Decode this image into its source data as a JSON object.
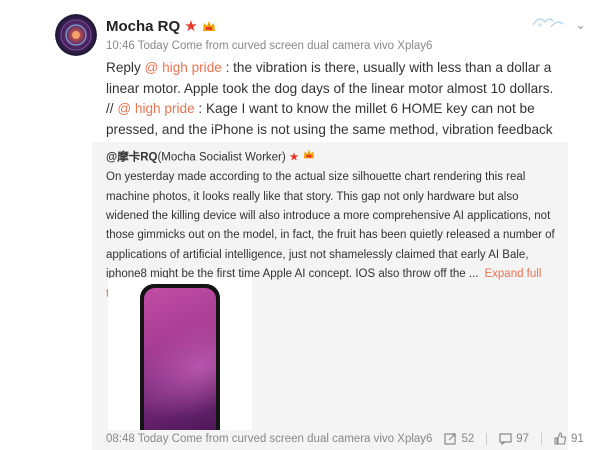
{
  "post": {
    "username": "Mocha RQ",
    "time": "10:46 Today",
    "source": "Come from curved screen dual camera vivo Xplay6",
    "text": {
      "reply_prefix": "Reply ",
      "mention1": "@ high pride",
      "part1": " : the vibration is there, usually with less than a dollar a linear motor. Apple took the dog days of the linear motor almost 10 dollars. // ",
      "mention2": "@ high pride",
      "part2": " : Kage I want to know the millet 6 HOME key can not be pressed, and the iPhone is not using the same method, vibration feedback it?"
    }
  },
  "repost": {
    "user": "@摩卡RQ",
    "user_desc": "(Mocha Socialist Worker)",
    "text": "On yesterday made according to the actual size silhouette chart rendering this real machine photos, it looks really like that story. This gap not only hardware but also widened the killing device will also introduce a more comprehensive AI applications, not those gimmicks out on the model, in fact, the fruit has been quietly released a number of applications of artificial intelligence, just not shamelessly claimed that early AI Bale, iphone8 might be the first time Apple AI concept. IOS also throw off the ...",
    "expand_label": "Expand full text",
    "footer_time": "08:48 Today",
    "footer_source": "Come from curved screen dual camera vivo Xplay6",
    "reposts": "52",
    "comments": "97",
    "likes": "91"
  },
  "colors": {
    "link": "#eb7350",
    "star": "#e8372d",
    "repost_bg": "#f4f4f4"
  },
  "icons": [
    "avatar",
    "star-icon",
    "vip-badge-icon",
    "bird-icon",
    "chevron-down-icon",
    "repost-icon",
    "comment-icon",
    "like-icon",
    "chevron-down-small-icon"
  ]
}
